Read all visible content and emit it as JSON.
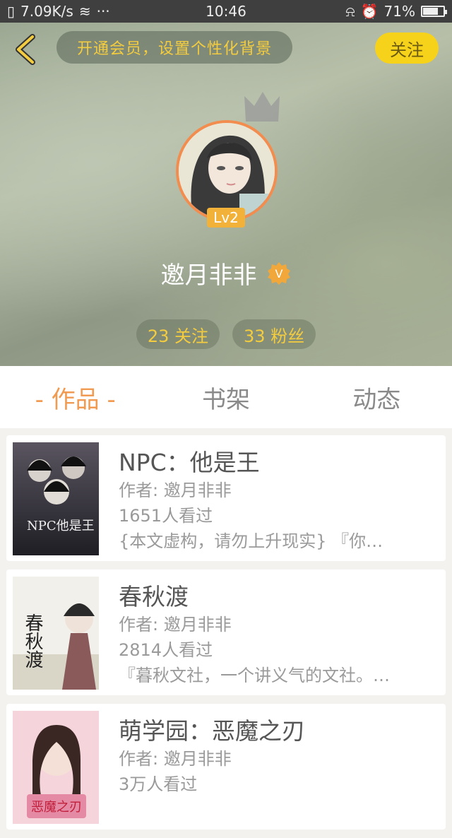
{
  "status_bar": {
    "net_speed": "7.09K/s",
    "dots": "···",
    "time": "10:46",
    "battery": "71%"
  },
  "header": {
    "member_banner": "开通会员，设置个性化背景",
    "follow_label": "关注",
    "level": "Lv2",
    "username": "邀月非非",
    "v_badge_text": "V",
    "following": "23 关注",
    "followers": "33 粉丝"
  },
  "tabs": [
    {
      "label": "- 作品 -",
      "active": true
    },
    {
      "label": "书架",
      "active": false
    },
    {
      "label": "动态",
      "active": false
    }
  ],
  "books": [
    {
      "title": "NPC：他是王",
      "author": "作者: 邀月非非",
      "views": "1651人看过",
      "summary": "{本文虚构，请勿上升现实} 『你…",
      "cover_text": "NPC他是王",
      "cover_colors": [
        "#1e1e24",
        "#5a5560"
      ]
    },
    {
      "title": "春秋渡",
      "author": "作者: 邀月非非",
      "views": "2814人看过",
      "summary": "『暮秋文社，一个讲义气的文社。…",
      "cover_text": "春秋渡",
      "cover_colors": [
        "#f1f0ea",
        "#d9d6c8"
      ]
    },
    {
      "title": "萌学园：恶魔之刃",
      "author": "作者: 邀月非非",
      "views": "3万人看过",
      "summary": "",
      "cover_text": "恶魔之刃",
      "cover_colors": [
        "#f6d4dc",
        "#e58aa4"
      ]
    }
  ],
  "colors": {
    "accent": "#f09a52",
    "gold": "#f3cc3f",
    "follow_bg": "#f6d21b"
  }
}
